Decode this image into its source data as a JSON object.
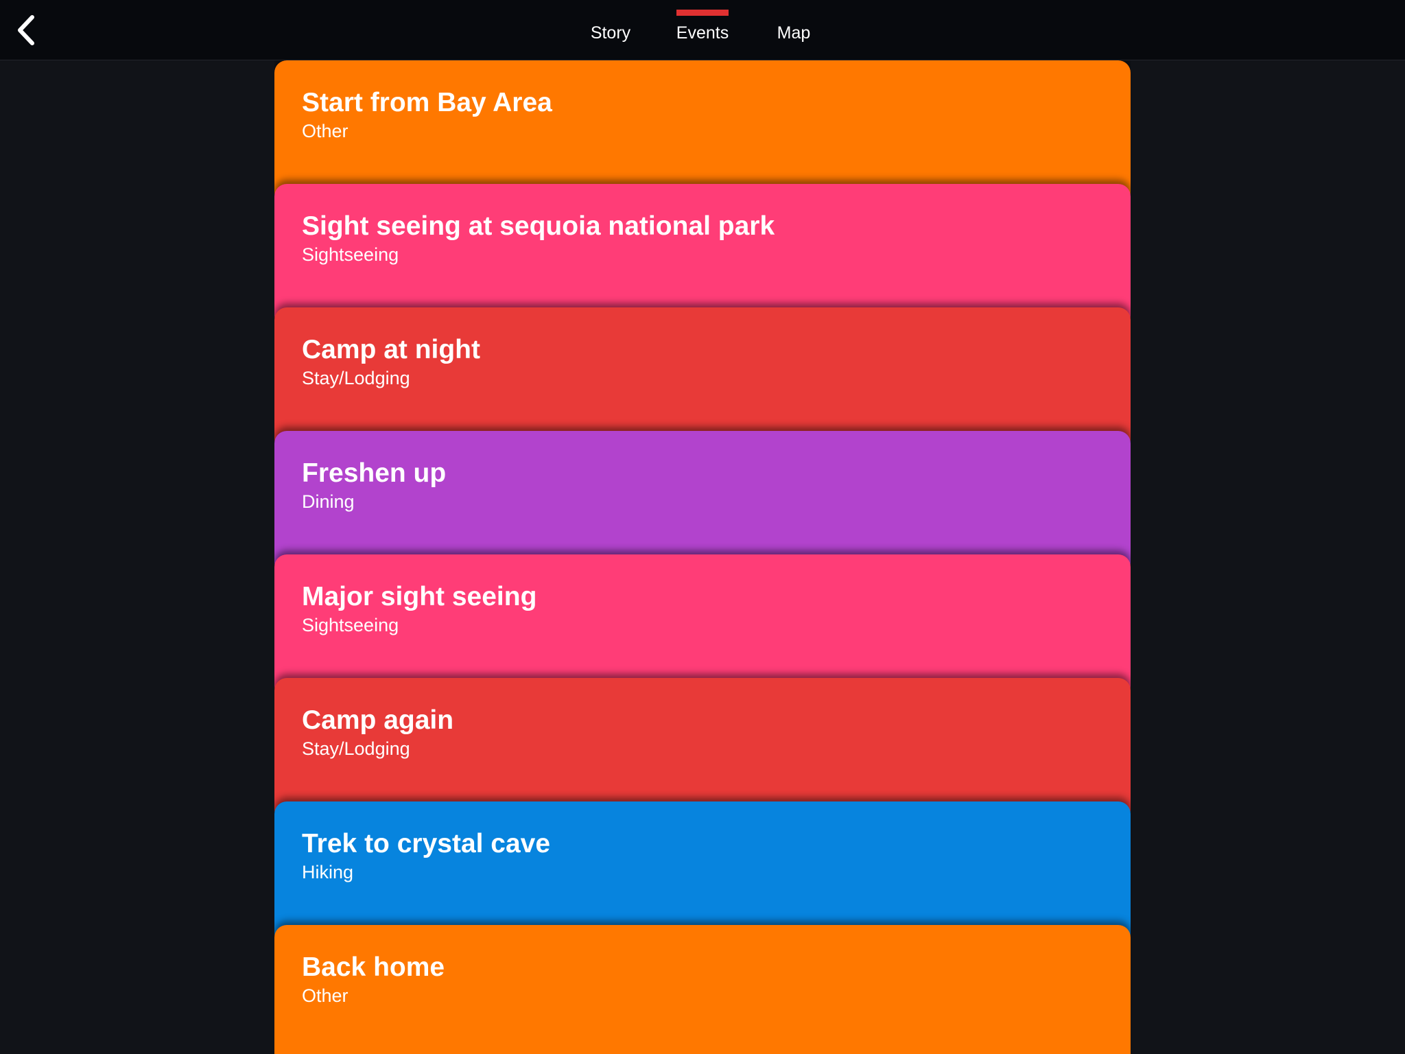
{
  "header": {
    "back_icon": "chevron-left-icon",
    "tabs": [
      {
        "label": "Story",
        "active": false
      },
      {
        "label": "Events",
        "active": true
      },
      {
        "label": "Map",
        "active": false
      }
    ],
    "active_indicator_color": "#e03131"
  },
  "events": [
    {
      "title": "Start from Bay Area",
      "category": "Other",
      "color": "#ff7800"
    },
    {
      "title": "Sight seeing at sequoia national park",
      "category": "Sightseeing",
      "color": "#ff3d77"
    },
    {
      "title": "Camp at night",
      "category": "Stay/Lodging",
      "color": "#e83a38"
    },
    {
      "title": "Freshen up",
      "category": "Dining",
      "color": "#b243cd"
    },
    {
      "title": "Major sight seeing",
      "category": "Sightseeing",
      "color": "#ff3d77"
    },
    {
      "title": "Camp again",
      "category": "Stay/Lodging",
      "color": "#e83a38"
    },
    {
      "title": "Trek to crystal cave",
      "category": "Hiking",
      "color": "#0784de"
    },
    {
      "title": "Back home",
      "category": "Other",
      "color": "#ff7800"
    }
  ]
}
